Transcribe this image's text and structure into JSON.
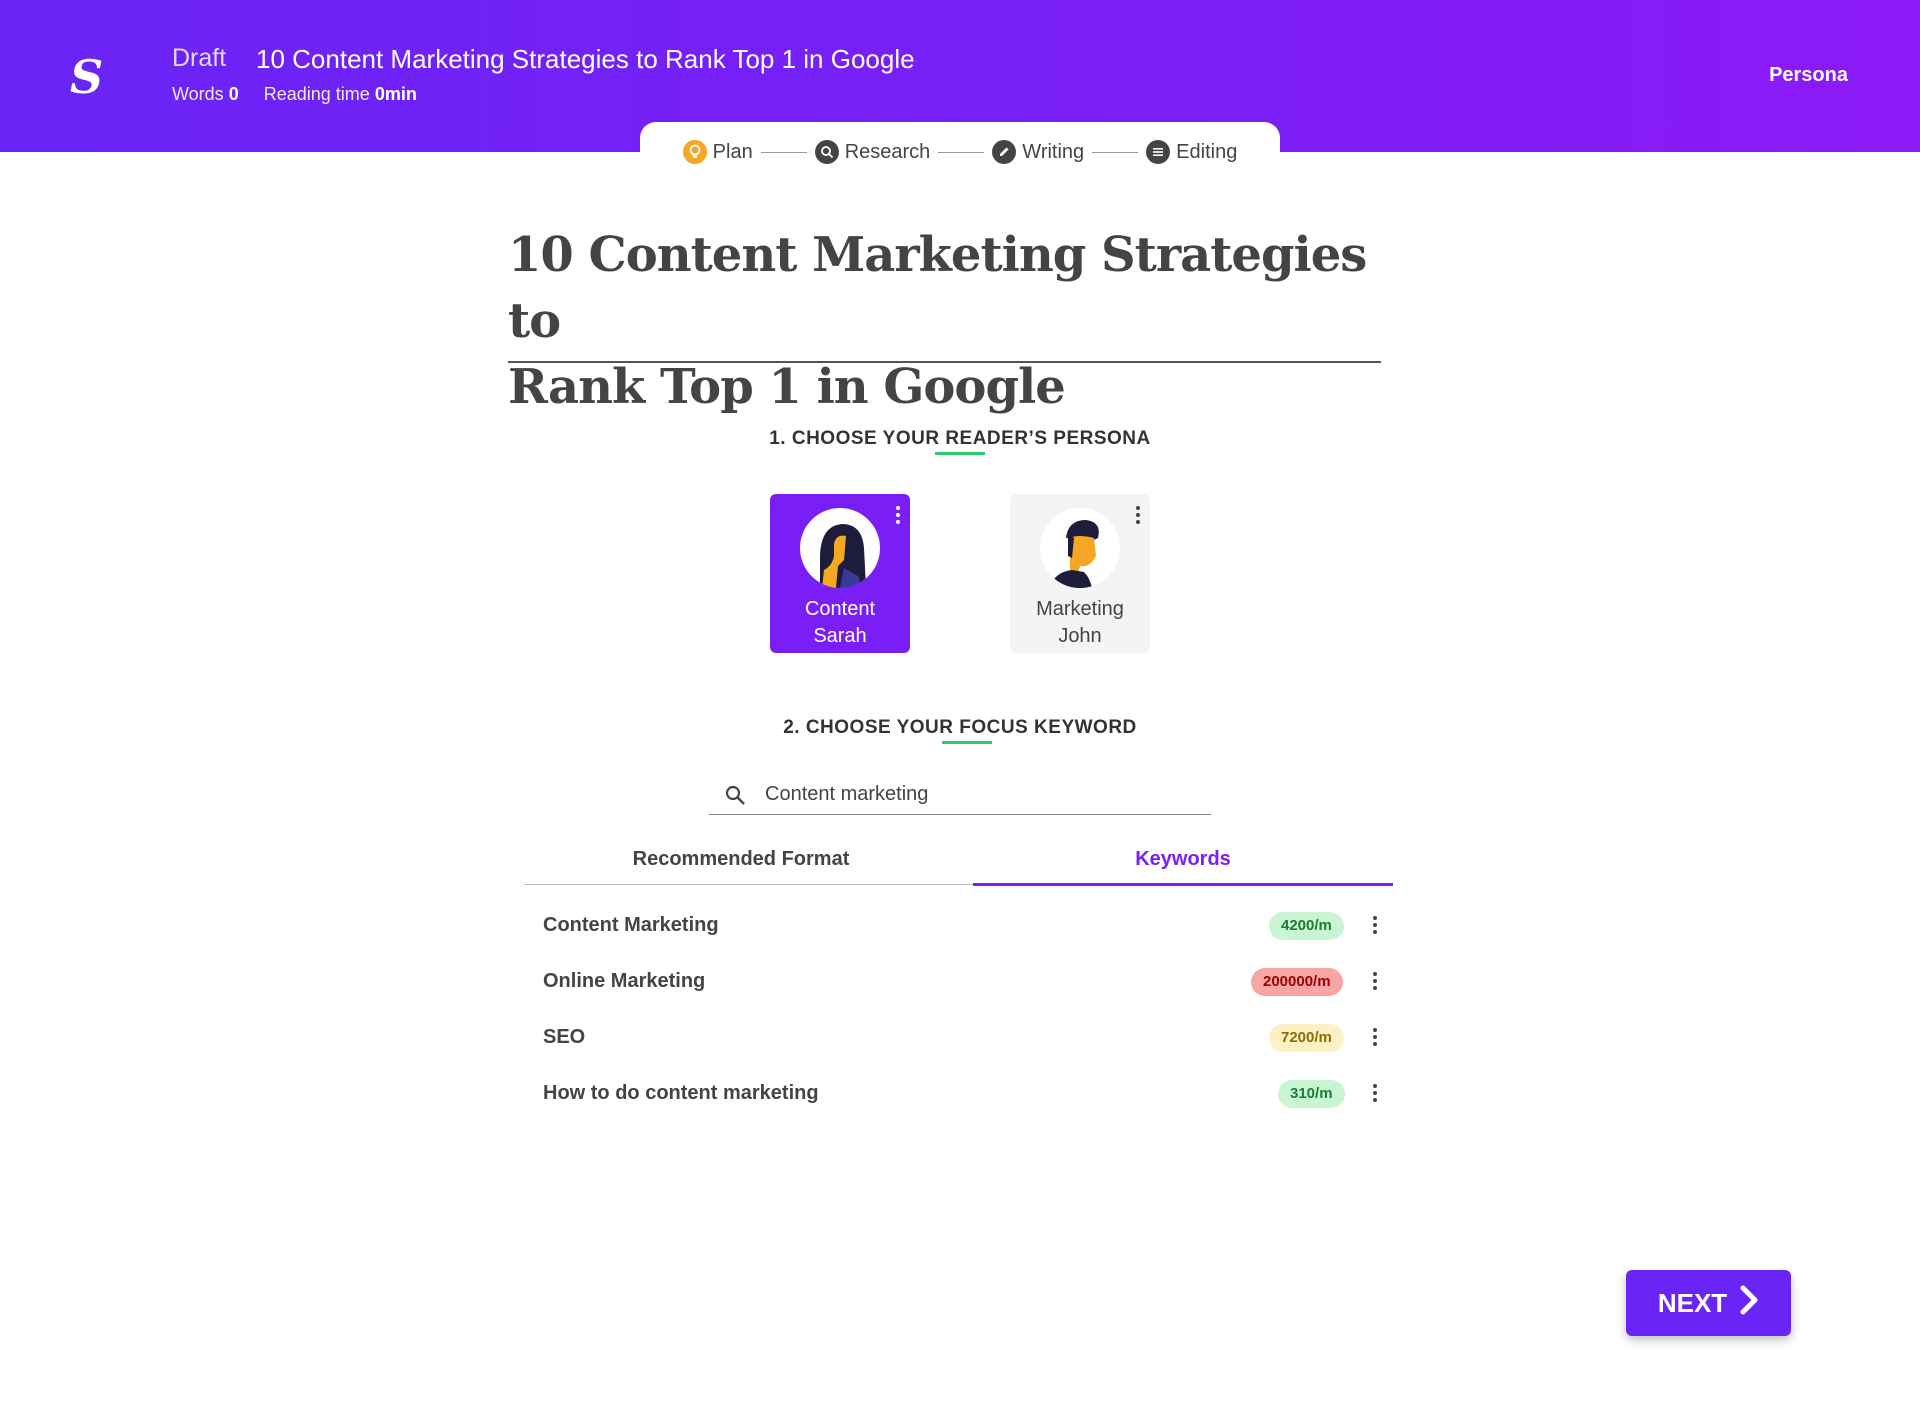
{
  "header": {
    "logo": "S",
    "status": "Draft",
    "doc_title": "10 Content Marketing Strategies to Rank Top 1 in Google",
    "words_label": "Words",
    "words_value": "0",
    "reading_label": "Reading time",
    "reading_value": "0min",
    "persona_link": "Persona"
  },
  "steps": [
    {
      "label": "Plan",
      "icon": "lightbulb-icon",
      "color": "#f5a623"
    },
    {
      "label": "Research",
      "icon": "search-icon",
      "color": "#444444"
    },
    {
      "label": "Writing",
      "icon": "pencil-icon",
      "color": "#444444"
    },
    {
      "label": "Editing",
      "icon": "editing-icon",
      "color": "#444444"
    }
  ],
  "article": {
    "title_line1": "10 Content Marketing Strategies to",
    "title_line2": "Rank Top 1 in Google"
  },
  "persona_section": {
    "title": "1. CHOOSE YOUR READER’S PERSONA",
    "personas": [
      {
        "line1": "Content",
        "line2": "Sarah",
        "selected": true
      },
      {
        "line1": "Marketing",
        "line2": "John",
        "selected": false
      }
    ]
  },
  "keyword_section": {
    "title": "2. CHOOSE YOUR FOCUS KEYWORD",
    "search_value": "Content marketing",
    "tabs": [
      {
        "label": "Recommended Format",
        "active": false
      },
      {
        "label": "Keywords",
        "active": true
      }
    ],
    "keywords": [
      {
        "name": "Content Marketing",
        "volume": "4200/m",
        "level": "green"
      },
      {
        "name": "Online Marketing",
        "volume": "200000/m",
        "level": "red"
      },
      {
        "name": "SEO",
        "volume": "7200/m",
        "level": "yellow"
      },
      {
        "name": "How to do content marketing",
        "volume": "310/m",
        "level": "green"
      }
    ]
  },
  "next_button": "NEXT",
  "colors": {
    "brand": "#6a24f6",
    "accent_underline": "#2ecc71",
    "badge_green_bg": "#c9f5d2",
    "badge_green_text": "#1a7d35",
    "badge_red_bg": "#f7a5a5",
    "badge_red_text": "#a00000",
    "badge_yellow_bg": "#fdf0c4",
    "badge_yellow_text": "#8a6d00"
  }
}
